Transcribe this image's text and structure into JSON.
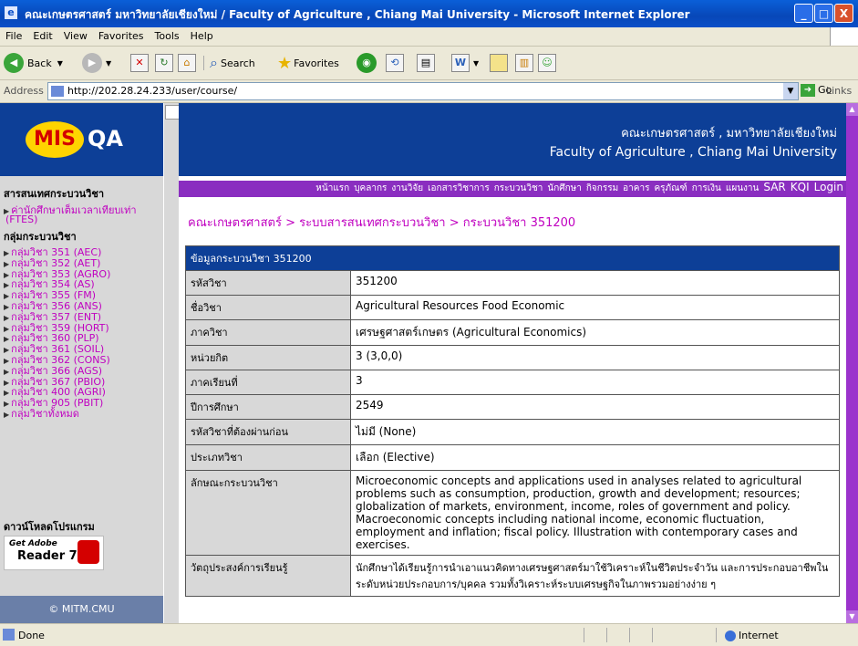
{
  "window": {
    "title": "คณะเกษตรศาสตร์ มหาวิทยาลัยเชียงใหม่ / Faculty of Agriculture , Chiang Mai University   - Microsoft Internet Explorer",
    "minimize": "_",
    "maximize": "□",
    "close": "X"
  },
  "menu": [
    "File",
    "Edit",
    "View",
    "Favorites",
    "Tools",
    "Help"
  ],
  "toolbar": {
    "back": "Back",
    "search": "Search",
    "favorites": "Favorites"
  },
  "address": {
    "label": "Address",
    "url": "http://202.28.24.233/user/course/",
    "go": "Go",
    "links": "Links"
  },
  "sidebar": {
    "logo_mis": "MIS",
    "logo_qa": "QA",
    "section1_title": "สารสนเทศกระบวนวิชา",
    "section1_links": [
      "ค่านักศึกษาเต็มเวลาเทียบเท่า",
      "(FTES)"
    ],
    "section2_title": "กลุ่มกระบวนวิชา",
    "groups": [
      "กลุ่มวิชา 351 (AEC)",
      "กลุ่มวิชา 352 (AET)",
      "กลุ่มวิชา 353 (AGRO)",
      "กลุ่มวิชา 354 (AS)",
      "กลุ่มวิชา 355 (FM)",
      "กลุ่มวิชา 356 (ANS)",
      "กลุ่มวิชา 357 (ENT)",
      "กลุ่มวิชา 359 (HORT)",
      "กลุ่มวิชา 360 (PLP)",
      "กลุ่มวิชา 361 (SOIL)",
      "กลุ่มวิชา 362 (CONS)",
      "กลุ่มวิชา 366 (AGS)",
      "กลุ่มวิชา 367 (PBIO)",
      "กลุ่มวิชา 400 (AGRI)",
      "กลุ่มวิชา 905 (PBIT)",
      "กลุ่มวิชาทั้งหมด"
    ],
    "download_title": "ดาวน์โหลดโปรแกรม",
    "reader_get": "Get Adobe",
    "reader_name": "Reader 7.0",
    "footer": "© MITM.CMU"
  },
  "banner": {
    "thai": "คณะเกษตรศาสตร์ , มหาวิทยาลัยเชียงใหม่",
    "english": "Faculty of Agriculture , Chiang Mai University"
  },
  "nav": [
    "หน้าแรก",
    "บุคลากร",
    "งานวิจัย",
    "เอกสารวิชาการ",
    "กระบวนวิชา",
    "นักศึกษา",
    "กิจกรรม",
    "อาคาร",
    "ครุภัณฑ์",
    "การเงิน",
    "แผนงาน"
  ],
  "nav_big": [
    "SAR",
    "KQI",
    "Login"
  ],
  "breadcrumb": "คณะเกษตรศาสตร์ > ระบบสารสนเทศกระบวนวิชา > กระบวนวิชา 351200",
  "course": {
    "header": "ข้อมูลกระบวนวิชา 351200",
    "rows": [
      {
        "label": "รหัสวิชา",
        "value": "351200"
      },
      {
        "label": "ชื่อวิชา",
        "value": "Agricultural Resources Food Economic"
      },
      {
        "label": "ภาควิชา",
        "value": "เศรษฐศาสตร์เกษตร (Agricultural Economics)"
      },
      {
        "label": "หน่วยกิต",
        "value": "3 (3,0,0)"
      },
      {
        "label": "ภาคเรียนที่",
        "value": "3"
      },
      {
        "label": "ปีการศึกษา",
        "value": "2549"
      },
      {
        "label": "รหัสวิชาที่ต้องผ่านก่อน",
        "value": "ไม่มี (None)"
      },
      {
        "label": "ประเภทวิชา",
        "value": "เลือก (Elective)"
      },
      {
        "label": "ลักษณะกระบวนวิชา",
        "value": "Microeconomic concepts and applications used in analyses related to agricultural problems such as consumption, production, growth and development; resources; globalization of markets, environment, income, roles of government and policy. Macroeconomic concepts including national income, economic fluctuation, employment and inflation; fiscal policy. Illustration with contemporary cases and exercises."
      },
      {
        "label": "วัตถุประสงค์การเรียนรู้",
        "value": "นักศึกษาได้เรียนรู้การนำเอาแนวคิดทางเศรษฐศาสตร์มาใช้วิเคราะห์ในชีวิตประจำวัน และการประกอบอาชีพในระดับหน่วยประกอบการ/บุคคล รวมทั้งวิเคราะห์ระบบเศรษฐกิจในภาพรวมอย่างง่าย ๆ"
      }
    ]
  },
  "status": {
    "text": "Done",
    "zone": "Internet"
  }
}
